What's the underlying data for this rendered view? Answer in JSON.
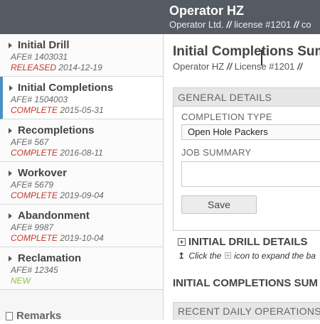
{
  "header": {
    "title": "Operator HZ",
    "company": "Operator Ltd.",
    "separator": "//",
    "license": "license #1201",
    "trailing": "co"
  },
  "sidebar": {
    "items": [
      {
        "label": "Initial Drill",
        "afe": "AFE# 1403031",
        "status": "RELEASED",
        "date": "2014-12-19",
        "status_color": "#c0392b"
      },
      {
        "label": "Initial Completions",
        "afe": "AFE# 1504003",
        "status": "COMPLETE",
        "date": "2015-05-31",
        "status_color": "#c0392b"
      },
      {
        "label": "Recompletions",
        "afe": "AFE# 567",
        "status": "COMPLETE",
        "date": "2016-08-11",
        "status_color": "#c0392b"
      },
      {
        "label": "Workover",
        "afe": "AFE# 5679",
        "status": "COMPLETE",
        "date": "2019-09-04",
        "status_color": "#c0392b"
      },
      {
        "label": "Abandonment",
        "afe": "AFE# 9987",
        "status": "COMPLETE",
        "date": "2019-10-04",
        "status_color": "#c0392b"
      },
      {
        "label": "Reclamation",
        "afe": "AFE# 12345",
        "status": "NEW",
        "date": "",
        "status_color": "#8bc34a"
      }
    ],
    "remarks_label": "Remarks"
  },
  "main": {
    "title": "Initial Completions Sum",
    "operator": "Operator HZ",
    "separator": "//",
    "license": "License #1201",
    "trailing_sep": "//",
    "general_details": {
      "heading": "GENERAL DETAILS",
      "completion_type_label": "COMPLETION TYPE",
      "completion_type_value": "Open Hole Packers",
      "job_summary_label": "JOB SUMMARY",
      "job_summary_value": "",
      "save_label": "Save"
    },
    "initial_drill_details": "INITIAL DRILL DETAILS",
    "hint_pre": "Click the",
    "hint_post": "icon to expand the ba",
    "summary_heading": "INITIAL COMPLETIONS SUM",
    "recent_heading": "RECENT DAILY OPERATIONS -"
  },
  "colors": {
    "header_bg": "#555b62",
    "active_accent": "#4a90c2",
    "status_red": "#c0392b",
    "status_new": "#8bc34a"
  }
}
